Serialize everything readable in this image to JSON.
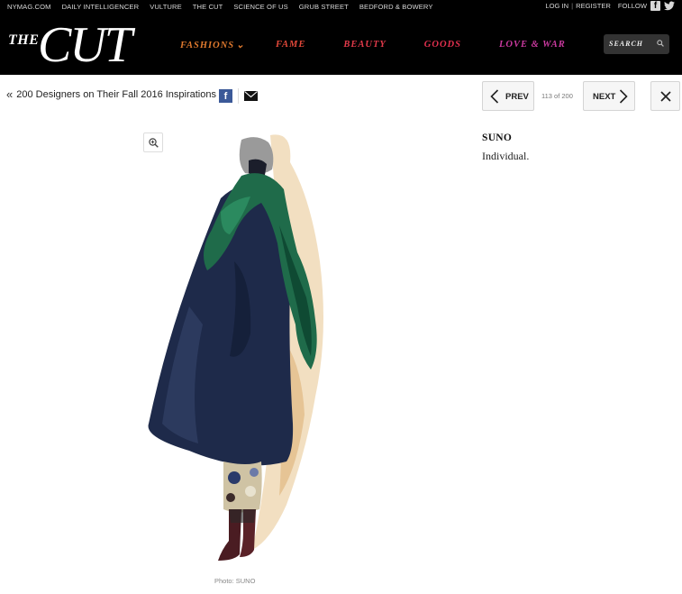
{
  "topbar": {
    "links": [
      "NYMAG.COM",
      "DAILY INTELLIGENCER",
      "VULTURE",
      "THE CUT",
      "SCIENCE OF US",
      "GRUB STREET",
      "BEDFORD & BOWERY"
    ],
    "login": "LOG IN",
    "separator": "|",
    "register": "REGISTER",
    "follow": "FOLLOW"
  },
  "logo": {
    "the": "THE",
    "cut": "CUT"
  },
  "nav": {
    "items": [
      "FASHIONS",
      "FAME",
      "BEAUTY",
      "GOODS",
      "LOVE & WAR"
    ],
    "colors": [
      "#e07a2e",
      "#e4493a",
      "#e23a4a",
      "#e2304f",
      "#cb3aa0"
    ],
    "search_label": "SEARCH"
  },
  "slideshow": {
    "back_arrow": "«",
    "back_label": "200 Designers on Their Fall 2016 Inspirations",
    "prev_label": "PREV",
    "next_label": "NEXT",
    "counter": "113 of 200"
  },
  "slide": {
    "photo_credit": "Photo: SUNO",
    "title": "SUNO",
    "text": "Individual."
  },
  "icons": [
    "facebook-icon",
    "twitter-icon",
    "search-icon",
    "mail-icon",
    "chevron-left-icon",
    "chevron-right-icon",
    "close-icon",
    "zoom-in-icon"
  ]
}
